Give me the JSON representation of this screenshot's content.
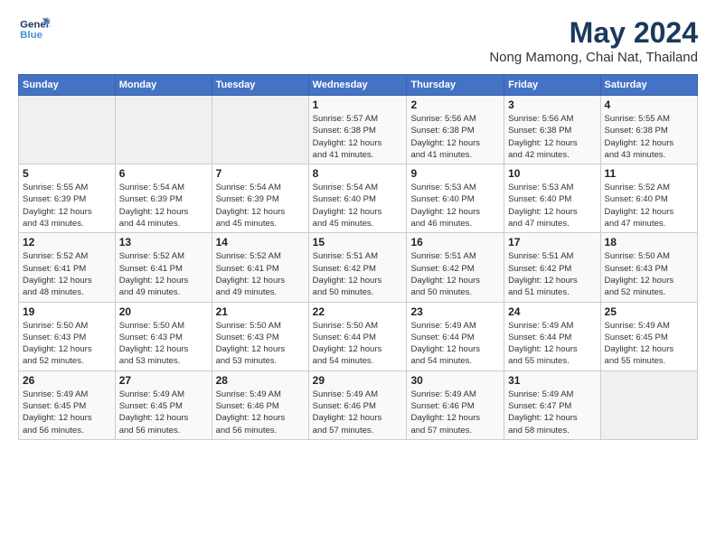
{
  "logo": {
    "line1": "General",
    "line2": "Blue",
    "icon_color": "#4a90d9"
  },
  "title": "May 2024",
  "subtitle": "Nong Mamong, Chai Nat, Thailand",
  "days_of_week": [
    "Sunday",
    "Monday",
    "Tuesday",
    "Wednesday",
    "Thursday",
    "Friday",
    "Saturday"
  ],
  "weeks": [
    [
      {
        "day": "",
        "info": ""
      },
      {
        "day": "",
        "info": ""
      },
      {
        "day": "",
        "info": ""
      },
      {
        "day": "1",
        "info": "Sunrise: 5:57 AM\nSunset: 6:38 PM\nDaylight: 12 hours\nand 41 minutes."
      },
      {
        "day": "2",
        "info": "Sunrise: 5:56 AM\nSunset: 6:38 PM\nDaylight: 12 hours\nand 41 minutes."
      },
      {
        "day": "3",
        "info": "Sunrise: 5:56 AM\nSunset: 6:38 PM\nDaylight: 12 hours\nand 42 minutes."
      },
      {
        "day": "4",
        "info": "Sunrise: 5:55 AM\nSunset: 6:38 PM\nDaylight: 12 hours\nand 43 minutes."
      }
    ],
    [
      {
        "day": "5",
        "info": "Sunrise: 5:55 AM\nSunset: 6:39 PM\nDaylight: 12 hours\nand 43 minutes."
      },
      {
        "day": "6",
        "info": "Sunrise: 5:54 AM\nSunset: 6:39 PM\nDaylight: 12 hours\nand 44 minutes."
      },
      {
        "day": "7",
        "info": "Sunrise: 5:54 AM\nSunset: 6:39 PM\nDaylight: 12 hours\nand 45 minutes."
      },
      {
        "day": "8",
        "info": "Sunrise: 5:54 AM\nSunset: 6:40 PM\nDaylight: 12 hours\nand 45 minutes."
      },
      {
        "day": "9",
        "info": "Sunrise: 5:53 AM\nSunset: 6:40 PM\nDaylight: 12 hours\nand 46 minutes."
      },
      {
        "day": "10",
        "info": "Sunrise: 5:53 AM\nSunset: 6:40 PM\nDaylight: 12 hours\nand 47 minutes."
      },
      {
        "day": "11",
        "info": "Sunrise: 5:52 AM\nSunset: 6:40 PM\nDaylight: 12 hours\nand 47 minutes."
      }
    ],
    [
      {
        "day": "12",
        "info": "Sunrise: 5:52 AM\nSunset: 6:41 PM\nDaylight: 12 hours\nand 48 minutes."
      },
      {
        "day": "13",
        "info": "Sunrise: 5:52 AM\nSunset: 6:41 PM\nDaylight: 12 hours\nand 49 minutes."
      },
      {
        "day": "14",
        "info": "Sunrise: 5:52 AM\nSunset: 6:41 PM\nDaylight: 12 hours\nand 49 minutes."
      },
      {
        "day": "15",
        "info": "Sunrise: 5:51 AM\nSunset: 6:42 PM\nDaylight: 12 hours\nand 50 minutes."
      },
      {
        "day": "16",
        "info": "Sunrise: 5:51 AM\nSunset: 6:42 PM\nDaylight: 12 hours\nand 50 minutes."
      },
      {
        "day": "17",
        "info": "Sunrise: 5:51 AM\nSunset: 6:42 PM\nDaylight: 12 hours\nand 51 minutes."
      },
      {
        "day": "18",
        "info": "Sunrise: 5:50 AM\nSunset: 6:43 PM\nDaylight: 12 hours\nand 52 minutes."
      }
    ],
    [
      {
        "day": "19",
        "info": "Sunrise: 5:50 AM\nSunset: 6:43 PM\nDaylight: 12 hours\nand 52 minutes."
      },
      {
        "day": "20",
        "info": "Sunrise: 5:50 AM\nSunset: 6:43 PM\nDaylight: 12 hours\nand 53 minutes."
      },
      {
        "day": "21",
        "info": "Sunrise: 5:50 AM\nSunset: 6:43 PM\nDaylight: 12 hours\nand 53 minutes."
      },
      {
        "day": "22",
        "info": "Sunrise: 5:50 AM\nSunset: 6:44 PM\nDaylight: 12 hours\nand 54 minutes."
      },
      {
        "day": "23",
        "info": "Sunrise: 5:49 AM\nSunset: 6:44 PM\nDaylight: 12 hours\nand 54 minutes."
      },
      {
        "day": "24",
        "info": "Sunrise: 5:49 AM\nSunset: 6:44 PM\nDaylight: 12 hours\nand 55 minutes."
      },
      {
        "day": "25",
        "info": "Sunrise: 5:49 AM\nSunset: 6:45 PM\nDaylight: 12 hours\nand 55 minutes."
      }
    ],
    [
      {
        "day": "26",
        "info": "Sunrise: 5:49 AM\nSunset: 6:45 PM\nDaylight: 12 hours\nand 56 minutes."
      },
      {
        "day": "27",
        "info": "Sunrise: 5:49 AM\nSunset: 6:45 PM\nDaylight: 12 hours\nand 56 minutes."
      },
      {
        "day": "28",
        "info": "Sunrise: 5:49 AM\nSunset: 6:46 PM\nDaylight: 12 hours\nand 56 minutes."
      },
      {
        "day": "29",
        "info": "Sunrise: 5:49 AM\nSunset: 6:46 PM\nDaylight: 12 hours\nand 57 minutes."
      },
      {
        "day": "30",
        "info": "Sunrise: 5:49 AM\nSunset: 6:46 PM\nDaylight: 12 hours\nand 57 minutes."
      },
      {
        "day": "31",
        "info": "Sunrise: 5:49 AM\nSunset: 6:47 PM\nDaylight: 12 hours\nand 58 minutes."
      },
      {
        "day": "",
        "info": ""
      }
    ]
  ]
}
